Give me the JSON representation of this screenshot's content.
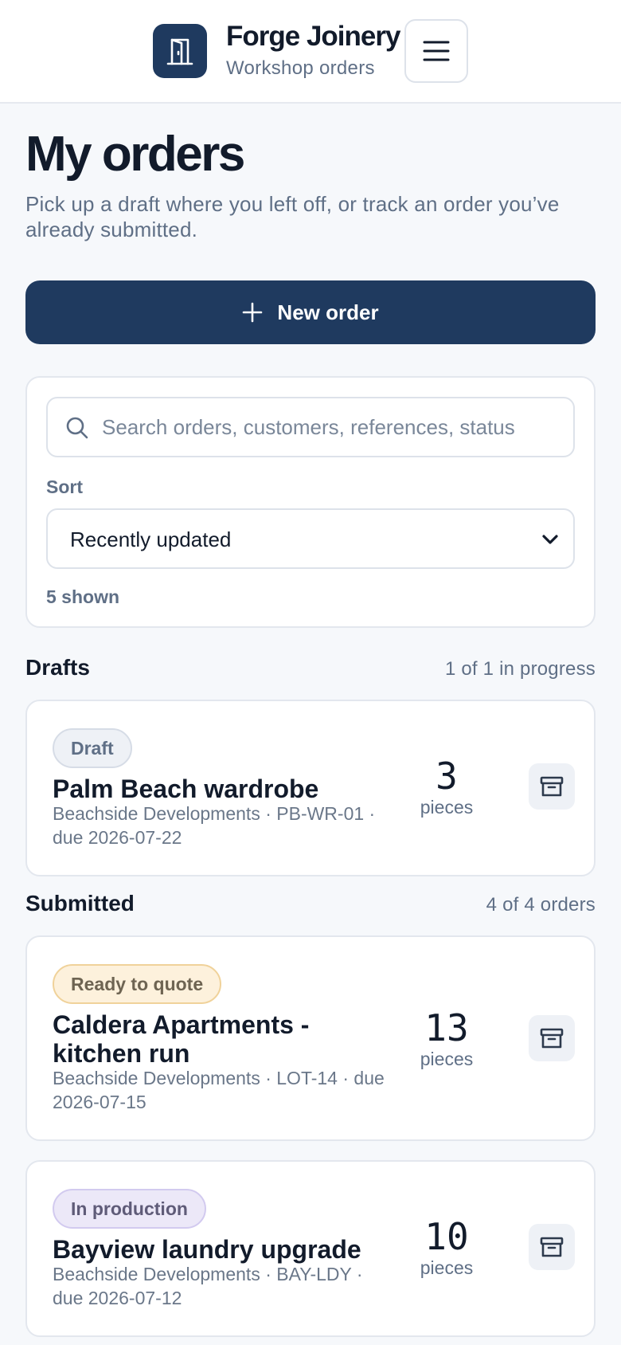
{
  "header": {
    "brand_name": "Forge Joinery",
    "brand_sub": "Workshop orders"
  },
  "page": {
    "title": "My orders",
    "subtitle": "Pick up a draft where you left off, or track an order you’ve already submitted.",
    "new_order_label": "New order"
  },
  "filters": {
    "search_placeholder": "Search orders, customers, references, status",
    "sort_label": "Sort",
    "sort_value": "Recently updated",
    "shown_text": "5 shown"
  },
  "drafts": {
    "title": "Drafts",
    "count_text": "1 of 1 in progress",
    "orders": [
      {
        "status": "Draft",
        "title": "Palm Beach wardrobe",
        "meta": "Beachside Developments · PB-WR-01 · due 2026-07-22",
        "pieces": "3",
        "pieces_label": "pieces"
      }
    ]
  },
  "submitted": {
    "title": "Submitted",
    "count_text": "4 of 4 orders",
    "orders": [
      {
        "status": "Ready to quote",
        "title": "Caldera Apartments - kitchen run",
        "meta": "Beachside Developments · LOT-14 · due 2026-07-15",
        "pieces": "13",
        "pieces_label": "pieces"
      },
      {
        "status": "In production",
        "title": "Bayview laundry upgrade",
        "meta": "Beachside Developments · BAY-LDY · due 2026-07-12",
        "pieces": "10",
        "pieces_label": "pieces"
      }
    ]
  },
  "icons": {
    "logo": "door-icon",
    "menu": "hamburger-menu-icon",
    "new": "plus-icon",
    "search": "search-icon",
    "sort": "chevron-down-icon",
    "archive": "archive-icon"
  },
  "colors": {
    "brand": "#1f3a5f",
    "background": "#f6f8fb",
    "text": "#121b2b",
    "muted": "#5f6f86"
  }
}
